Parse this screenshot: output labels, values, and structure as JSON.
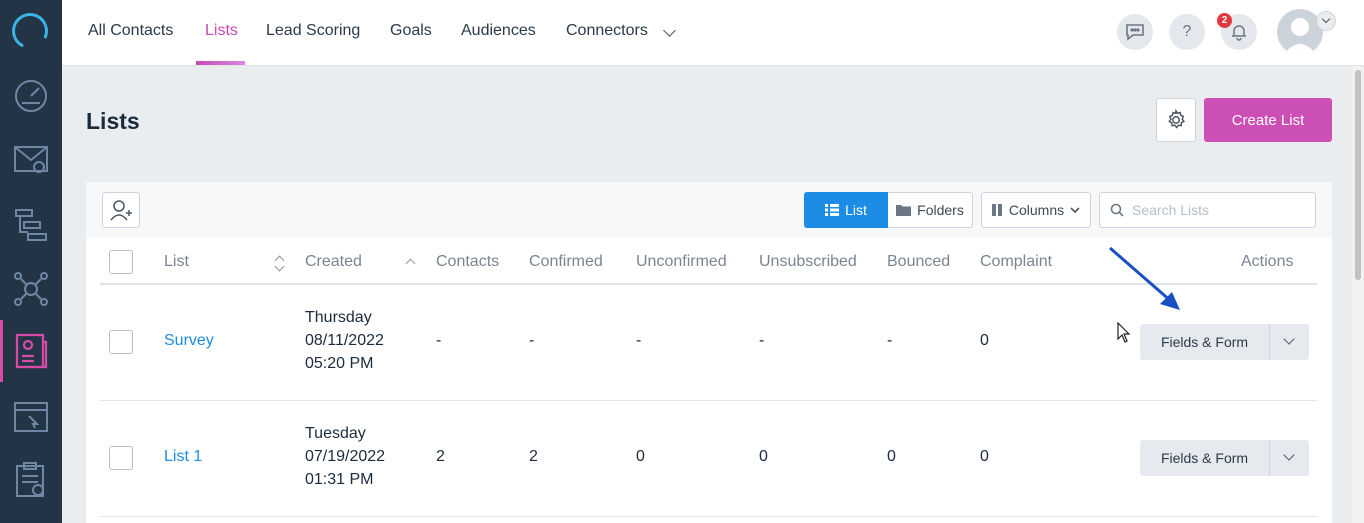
{
  "nav": {
    "tabs": [
      "All Contacts",
      "Lists",
      "Lead Scoring",
      "Goals",
      "Audiences",
      "Connectors"
    ],
    "active_tab": "Lists",
    "notification_count": "2",
    "help_label": "?"
  },
  "page": {
    "title": "Lists",
    "create_label": "Create List"
  },
  "toolbar": {
    "view_list": "List",
    "view_folders": "Folders",
    "columns_label": "Columns",
    "search_placeholder": "Search Lists"
  },
  "table": {
    "columns": [
      "List",
      "Created",
      "Contacts",
      "Confirmed",
      "Unconfirmed",
      "Unsubscribed",
      "Bounced",
      "Complaint",
      "Actions"
    ],
    "rows": [
      {
        "name": "Survey",
        "day": "Thursday",
        "date": "08/11/2022",
        "time": "05:20 PM",
        "contacts": "-",
        "confirmed": "-",
        "unconfirmed": "-",
        "unsubscribed": "-",
        "bounced": "-",
        "complaint": "0",
        "action": "Fields & Form"
      },
      {
        "name": "List 1",
        "day": "Tuesday",
        "date": "07/19/2022",
        "time": "01:31 PM",
        "contacts": "2",
        "confirmed": "2",
        "unconfirmed": "0",
        "unsubscribed": "0",
        "bounced": "0",
        "complaint": "0",
        "action": "Fields & Form"
      }
    ]
  },
  "colors": {
    "accent": "#cc4fb6",
    "link": "#1c8ce4",
    "rail": "#243447",
    "annotation_arrow": "#1a4fc4"
  }
}
